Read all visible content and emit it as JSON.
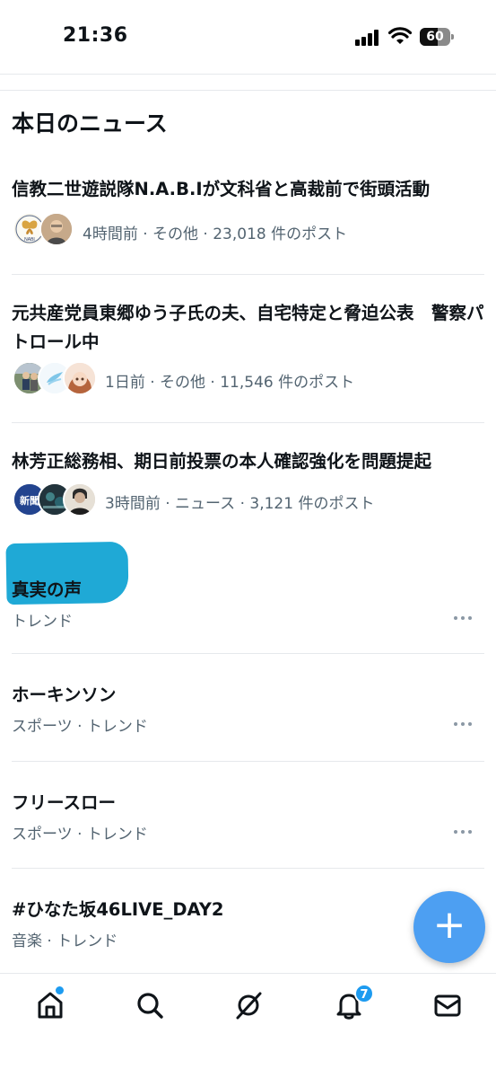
{
  "status_bar": {
    "time": "21:36",
    "battery_level": "60"
  },
  "section": {
    "title": "本日のニュース"
  },
  "news": [
    {
      "headline": "信教二世遊説隊N.A.B.Iが文科省と高裁前で街頭活動",
      "meta": "4時間前 · その他 · 23,018 件のポスト",
      "avatar_text": "NABI"
    },
    {
      "headline": "元共産党員東郷ゆう子氏の夫、自宅特定と脅迫公表　警察パトロール中",
      "meta": "1日前 · その他 · 11,546 件のポスト"
    },
    {
      "headline": "林芳正総務相、期日前投票の本人確認強化を問題提起",
      "meta": "3時間前 · ニュース · 3,121 件のポスト",
      "avatar_text": "新聞"
    }
  ],
  "trends": [
    {
      "name": "真実の声",
      "meta": "トレンド"
    },
    {
      "name": "ホーキンソン",
      "meta": "スポーツ · トレンド"
    },
    {
      "name": "フリースロー",
      "meta": "スポーツ · トレンド"
    },
    {
      "name": "#ひなた坂46LIVE_DAY2",
      "meta": "音楽 · トレンド"
    }
  ],
  "fab": {
    "label": "+"
  },
  "tabbar": {
    "notifications_badge": "7",
    "icons": [
      "home-icon",
      "search-icon",
      "grok-icon",
      "notifications-icon",
      "messages-icon"
    ]
  },
  "colors": {
    "accent": "#1d9bf0",
    "fab": "#4d9ff2",
    "highlight": "#1fa9d6",
    "secondary_text": "#536471"
  }
}
